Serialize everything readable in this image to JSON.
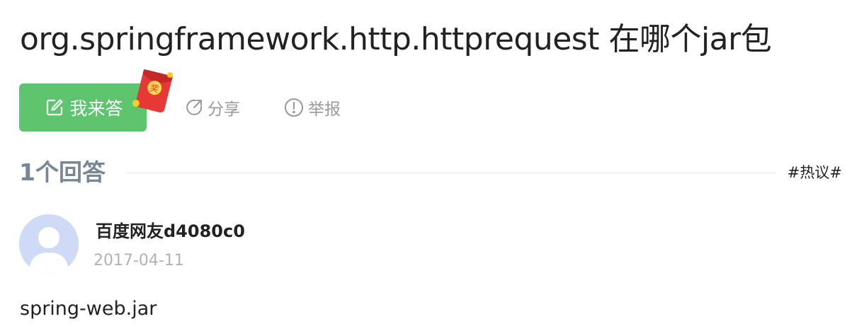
{
  "question": {
    "title": "org.springframework.http.httprequest 在哪个jar包"
  },
  "actions": {
    "answer_label": "我来答",
    "redpacket_text": "奖",
    "share_label": "分享",
    "report_label": "举报"
  },
  "answers": {
    "count_label": "1个回答",
    "hot_tag": "#热议#",
    "items": [
      {
        "user": "百度网友d4080c0",
        "date": "2017-04-11",
        "content": "spring-web.jar"
      }
    ]
  },
  "colors": {
    "answer_button": "#5fc46e",
    "muted_text": "#999999",
    "count_text": "#788796",
    "redpacket": "#e53935",
    "avatar_bg": "#cfdaf7"
  },
  "icons": {
    "answer": "edit-icon",
    "share": "share-icon",
    "report": "alert-circle-icon",
    "badge": "red-envelope-icon"
  }
}
